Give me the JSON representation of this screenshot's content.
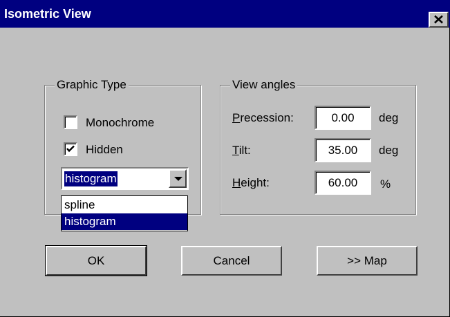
{
  "window": {
    "title": "Isometric View"
  },
  "graphic_type": {
    "legend": "Graphic Type",
    "monochrome": {
      "label": "Monochrome",
      "checked": false
    },
    "hidden": {
      "label": "Hidden",
      "checked": true
    },
    "combo": {
      "value": "histogram",
      "options": [
        "spline",
        "histogram"
      ],
      "selected_index": 1
    }
  },
  "view_angles": {
    "legend": "View angles",
    "precession": {
      "label_first": "P",
      "label_rest": "recession:",
      "value": "0.00",
      "unit": "deg"
    },
    "tilt": {
      "label_first": "T",
      "label_rest": "ilt:",
      "value": "35.00",
      "unit": "deg"
    },
    "height": {
      "label_first": "H",
      "label_rest": "eight:",
      "value": "60.00",
      "unit": "%"
    }
  },
  "buttons": {
    "ok": "OK",
    "cancel": "Cancel",
    "map": ">> Map"
  },
  "colors": {
    "titlebar": "#000080",
    "face": "#c0c0c0",
    "selection": "#000080"
  },
  "icons": {
    "close": "close-icon",
    "check": "checkmark-icon",
    "dropdown": "dropdown-arrow-icon"
  }
}
